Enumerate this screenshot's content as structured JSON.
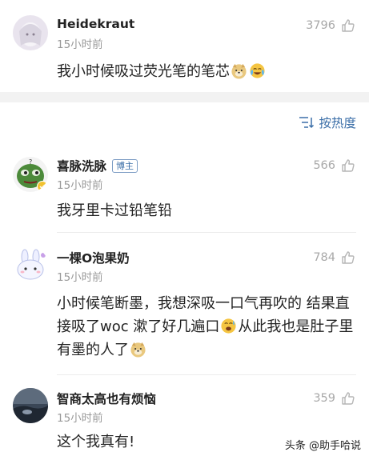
{
  "comments": [
    {
      "author": "Heidekraut",
      "time": "15小时前",
      "likes": "3796",
      "text": "我小时候吸过荧光笔的笔芯",
      "emojis": [
        "doge-emoji",
        "cry-laugh-emoji"
      ]
    },
    {
      "author": "喜脉洗脉",
      "badge": "博主",
      "time": "15小时前",
      "likes": "566",
      "text": "我牙里卡过铅笔铅"
    },
    {
      "author": "一棵O泡果奶",
      "time": "15小时前",
      "likes": "784",
      "text_part1": "小时候笔断墨，我想深吸一口气再吹的 结果直接吸了woc 漱了好几遍口",
      "text_part2": "从此我也是肚子里有墨的人了"
    },
    {
      "author": "智商太高也有烦恼",
      "time": "15小时前",
      "likes": "359",
      "text": "这个我真有!"
    }
  ],
  "sort": {
    "label": "按热度"
  },
  "watermark": {
    "text": "头条 @助手哈说"
  },
  "colors": {
    "link": "#3c6fa8",
    "muted": "#9a9a9a",
    "band": "#f2f2f2"
  }
}
